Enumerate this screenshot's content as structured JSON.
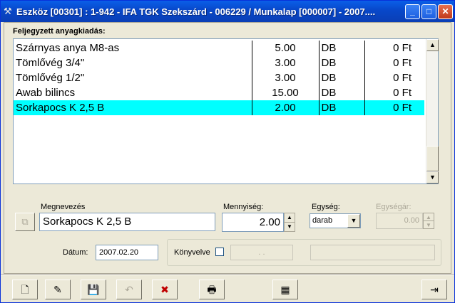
{
  "window": {
    "title": "Eszköz [00301] : 1-942 - IFA TGK Szekszárd - 006229  / Munkalap [000007] - 2007....",
    "app_icon": "tools-icon",
    "minimize_glyph": "_",
    "maximize_glyph": "□",
    "close_glyph": "✕"
  },
  "section": {
    "label": "Feljegyzett anyagkiadás:"
  },
  "table": {
    "rows": [
      {
        "name": "Szárnyas anya M8-as",
        "qty": "5.00",
        "unit": "DB",
        "price": "0 Ft",
        "selected": false
      },
      {
        "name": "Tömlővég 3/4\"",
        "qty": "3.00",
        "unit": "DB",
        "price": "0 Ft",
        "selected": false
      },
      {
        "name": "Tömlővég 1/2\"",
        "qty": "3.00",
        "unit": "DB",
        "price": "0 Ft",
        "selected": false
      },
      {
        "name": "Awab bilincs",
        "qty": "15.00",
        "unit": "DB",
        "price": "0 Ft",
        "selected": false
      },
      {
        "name": "Sorkapocs K 2,5 B",
        "qty": "2.00",
        "unit": "DB",
        "price": "0 Ft",
        "selected": true
      }
    ]
  },
  "form": {
    "name_label": "Megnevezés",
    "name_value": "Sorkapocs K 2,5 B",
    "qty_label": "Mennyiség:",
    "qty_value": "2.00",
    "unit_label": "Egység:",
    "unit_value": "darab",
    "unit_price_label": "Egységár:",
    "unit_price_value": "0.00",
    "date_label": "Dátum:",
    "date_value": "2007.02.20",
    "booked_label": "Könyvelve",
    "booked_date_value": ". .",
    "booked_extra_value": ""
  },
  "colors": {
    "selection": "#00ffff",
    "titlebar": "#0847c9"
  },
  "toolbar": {
    "buttons": [
      {
        "icon": "new-document-icon",
        "glyph": "🗋",
        "enabled": true
      },
      {
        "icon": "edit-icon",
        "glyph": "✎",
        "enabled": true
      },
      {
        "icon": "save-icon",
        "glyph": "💾",
        "enabled": false
      },
      {
        "icon": "undo-icon",
        "glyph": "↶",
        "enabled": false
      },
      {
        "icon": "delete-icon",
        "glyph": "✖",
        "enabled": true
      },
      {
        "icon": "print-icon",
        "glyph": "🖶",
        "enabled": true
      },
      {
        "icon": "calculator-icon",
        "glyph": "▦",
        "enabled": true
      },
      {
        "icon": "exit-icon",
        "glyph": "⇥",
        "enabled": true
      }
    ]
  }
}
